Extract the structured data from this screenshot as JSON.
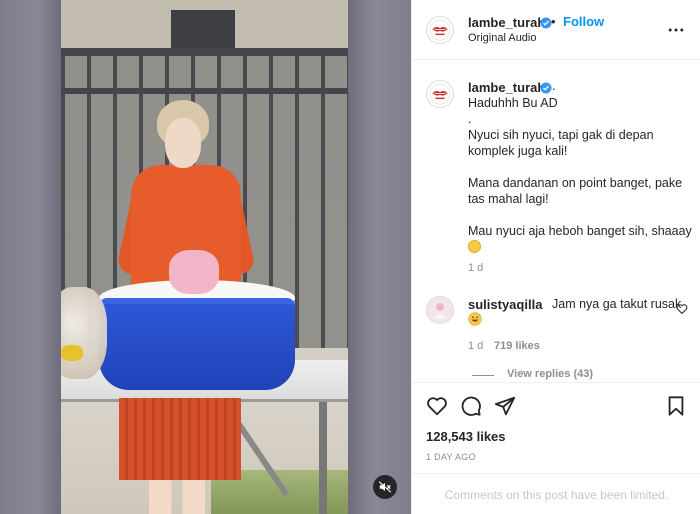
{
  "post": {
    "username": "lambe_turah",
    "dot": "•",
    "follow_label": "Follow",
    "audio_label": "Original Audio"
  },
  "caption": {
    "username": "lambe_turah",
    "dot": ".",
    "text": "Haduhhh Bu AD\n.\nNyuci sih nyuci, tapi gak di depan komplek juga kali!\n\nMana dandanan on point banget, pake tas mahal lagi!\n\nMau nyuci aja heboh banget sih, shaaay",
    "emoji": "grimacing-face-emoji",
    "time": "1 d"
  },
  "comment": {
    "username": "sulistyaqilla",
    "text": "Jam nya ga takut rusak",
    "emoji": "grinning-sweat-emoji",
    "time": "1 d",
    "likes": "719 likes",
    "view_replies": "View replies (43)"
  },
  "actions": {
    "likes": "128,543 likes",
    "date": "1 DAY AGO",
    "comments_limited": "Comments on this post have been limited."
  },
  "icons": {
    "header_more": "more-horizontal-icon",
    "verified": "verified-badge-icon",
    "like": "heart-icon",
    "comment": "comment-icon",
    "share": "send-icon",
    "save": "bookmark-icon",
    "mute": "audio-muted-icon"
  },
  "colors": {
    "accent": "#0095f6",
    "verified": "#3897f0",
    "text": "#262626",
    "muted": "#8e8e8e"
  }
}
